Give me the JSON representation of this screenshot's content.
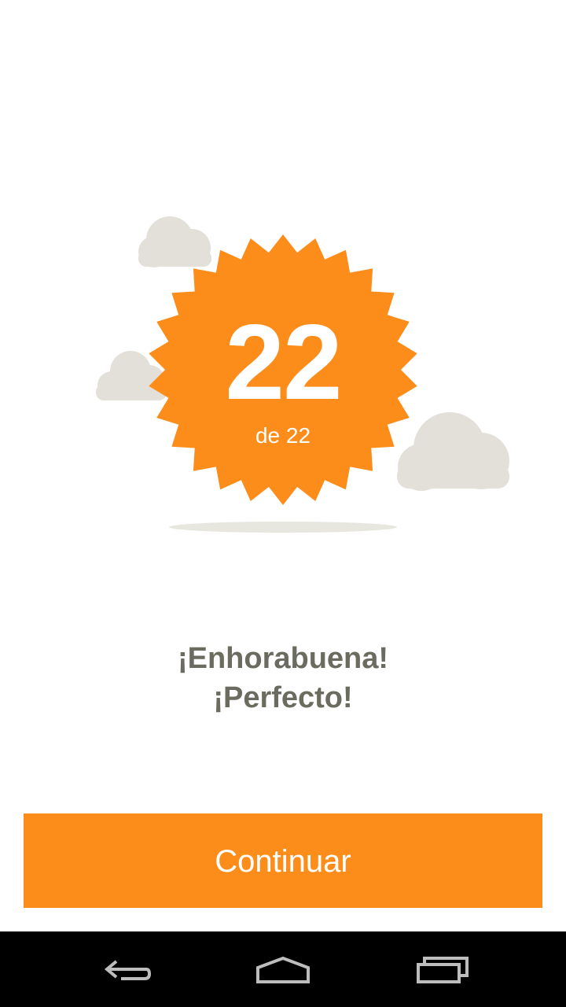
{
  "result": {
    "score": "22",
    "total_label": "de 22"
  },
  "message": {
    "line1": "¡Enhorabuena!",
    "line2": "¡Perfecto!"
  },
  "actions": {
    "continue_label": "Continuar"
  },
  "navbar": {
    "back_icon": "back-icon",
    "home_icon": "home-icon",
    "recents_icon": "recent-apps-icon"
  },
  "colors": {
    "accent": "#fd8d1b",
    "cloud": "#e2e0d8",
    "text": "#6b6b5f",
    "navbar": "#000000"
  }
}
